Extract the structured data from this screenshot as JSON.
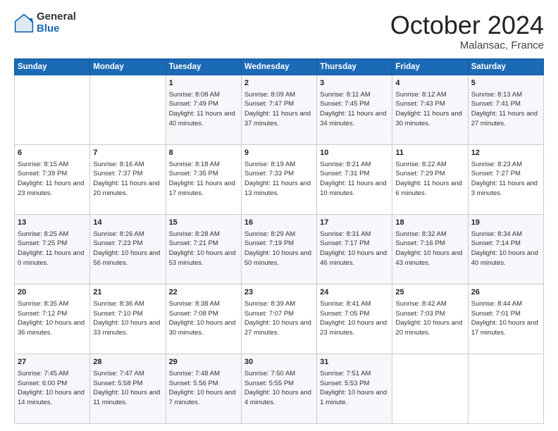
{
  "logo": {
    "general": "General",
    "blue": "Blue"
  },
  "header": {
    "month": "October 2024",
    "location": "Malansac, France"
  },
  "weekdays": [
    "Sunday",
    "Monday",
    "Tuesday",
    "Wednesday",
    "Thursday",
    "Friday",
    "Saturday"
  ],
  "weeks": [
    [
      {
        "day": "",
        "sunrise": "",
        "sunset": "",
        "daylight": ""
      },
      {
        "day": "",
        "sunrise": "",
        "sunset": "",
        "daylight": ""
      },
      {
        "day": "1",
        "sunrise": "Sunrise: 8:08 AM",
        "sunset": "Sunset: 7:49 PM",
        "daylight": "Daylight: 11 hours and 40 minutes."
      },
      {
        "day": "2",
        "sunrise": "Sunrise: 8:09 AM",
        "sunset": "Sunset: 7:47 PM",
        "daylight": "Daylight: 11 hours and 37 minutes."
      },
      {
        "day": "3",
        "sunrise": "Sunrise: 8:11 AM",
        "sunset": "Sunset: 7:45 PM",
        "daylight": "Daylight: 11 hours and 34 minutes."
      },
      {
        "day": "4",
        "sunrise": "Sunrise: 8:12 AM",
        "sunset": "Sunset: 7:43 PM",
        "daylight": "Daylight: 11 hours and 30 minutes."
      },
      {
        "day": "5",
        "sunrise": "Sunrise: 8:13 AM",
        "sunset": "Sunset: 7:41 PM",
        "daylight": "Daylight: 11 hours and 27 minutes."
      }
    ],
    [
      {
        "day": "6",
        "sunrise": "Sunrise: 8:15 AM",
        "sunset": "Sunset: 7:39 PM",
        "daylight": "Daylight: 11 hours and 23 minutes."
      },
      {
        "day": "7",
        "sunrise": "Sunrise: 8:16 AM",
        "sunset": "Sunset: 7:37 PM",
        "daylight": "Daylight: 11 hours and 20 minutes."
      },
      {
        "day": "8",
        "sunrise": "Sunrise: 8:18 AM",
        "sunset": "Sunset: 7:35 PM",
        "daylight": "Daylight: 11 hours and 17 minutes."
      },
      {
        "day": "9",
        "sunrise": "Sunrise: 8:19 AM",
        "sunset": "Sunset: 7:33 PM",
        "daylight": "Daylight: 11 hours and 13 minutes."
      },
      {
        "day": "10",
        "sunrise": "Sunrise: 8:21 AM",
        "sunset": "Sunset: 7:31 PM",
        "daylight": "Daylight: 11 hours and 10 minutes."
      },
      {
        "day": "11",
        "sunrise": "Sunrise: 8:22 AM",
        "sunset": "Sunset: 7:29 PM",
        "daylight": "Daylight: 11 hours and 6 minutes."
      },
      {
        "day": "12",
        "sunrise": "Sunrise: 8:23 AM",
        "sunset": "Sunset: 7:27 PM",
        "daylight": "Daylight: 11 hours and 3 minutes."
      }
    ],
    [
      {
        "day": "13",
        "sunrise": "Sunrise: 8:25 AM",
        "sunset": "Sunset: 7:25 PM",
        "daylight": "Daylight: 11 hours and 0 minutes."
      },
      {
        "day": "14",
        "sunrise": "Sunrise: 8:26 AM",
        "sunset": "Sunset: 7:23 PM",
        "daylight": "Daylight: 10 hours and 56 minutes."
      },
      {
        "day": "15",
        "sunrise": "Sunrise: 8:28 AM",
        "sunset": "Sunset: 7:21 PM",
        "daylight": "Daylight: 10 hours and 53 minutes."
      },
      {
        "day": "16",
        "sunrise": "Sunrise: 8:29 AM",
        "sunset": "Sunset: 7:19 PM",
        "daylight": "Daylight: 10 hours and 50 minutes."
      },
      {
        "day": "17",
        "sunrise": "Sunrise: 8:31 AM",
        "sunset": "Sunset: 7:17 PM",
        "daylight": "Daylight: 10 hours and 46 minutes."
      },
      {
        "day": "18",
        "sunrise": "Sunrise: 8:32 AM",
        "sunset": "Sunset: 7:16 PM",
        "daylight": "Daylight: 10 hours and 43 minutes."
      },
      {
        "day": "19",
        "sunrise": "Sunrise: 8:34 AM",
        "sunset": "Sunset: 7:14 PM",
        "daylight": "Daylight: 10 hours and 40 minutes."
      }
    ],
    [
      {
        "day": "20",
        "sunrise": "Sunrise: 8:35 AM",
        "sunset": "Sunset: 7:12 PM",
        "daylight": "Daylight: 10 hours and 36 minutes."
      },
      {
        "day": "21",
        "sunrise": "Sunrise: 8:36 AM",
        "sunset": "Sunset: 7:10 PM",
        "daylight": "Daylight: 10 hours and 33 minutes."
      },
      {
        "day": "22",
        "sunrise": "Sunrise: 8:38 AM",
        "sunset": "Sunset: 7:08 PM",
        "daylight": "Daylight: 10 hours and 30 minutes."
      },
      {
        "day": "23",
        "sunrise": "Sunrise: 8:39 AM",
        "sunset": "Sunset: 7:07 PM",
        "daylight": "Daylight: 10 hours and 27 minutes."
      },
      {
        "day": "24",
        "sunrise": "Sunrise: 8:41 AM",
        "sunset": "Sunset: 7:05 PM",
        "daylight": "Daylight: 10 hours and 23 minutes."
      },
      {
        "day": "25",
        "sunrise": "Sunrise: 8:42 AM",
        "sunset": "Sunset: 7:03 PM",
        "daylight": "Daylight: 10 hours and 20 minutes."
      },
      {
        "day": "26",
        "sunrise": "Sunrise: 8:44 AM",
        "sunset": "Sunset: 7:01 PM",
        "daylight": "Daylight: 10 hours and 17 minutes."
      }
    ],
    [
      {
        "day": "27",
        "sunrise": "Sunrise: 7:45 AM",
        "sunset": "Sunset: 6:00 PM",
        "daylight": "Daylight: 10 hours and 14 minutes."
      },
      {
        "day": "28",
        "sunrise": "Sunrise: 7:47 AM",
        "sunset": "Sunset: 5:58 PM",
        "daylight": "Daylight: 10 hours and 11 minutes."
      },
      {
        "day": "29",
        "sunrise": "Sunrise: 7:48 AM",
        "sunset": "Sunset: 5:56 PM",
        "daylight": "Daylight: 10 hours and 7 minutes."
      },
      {
        "day": "30",
        "sunrise": "Sunrise: 7:50 AM",
        "sunset": "Sunset: 5:55 PM",
        "daylight": "Daylight: 10 hours and 4 minutes."
      },
      {
        "day": "31",
        "sunrise": "Sunrise: 7:51 AM",
        "sunset": "Sunset: 5:53 PM",
        "daylight": "Daylight: 10 hours and 1 minute."
      },
      {
        "day": "",
        "sunrise": "",
        "sunset": "",
        "daylight": ""
      },
      {
        "day": "",
        "sunrise": "",
        "sunset": "",
        "daylight": ""
      }
    ]
  ]
}
